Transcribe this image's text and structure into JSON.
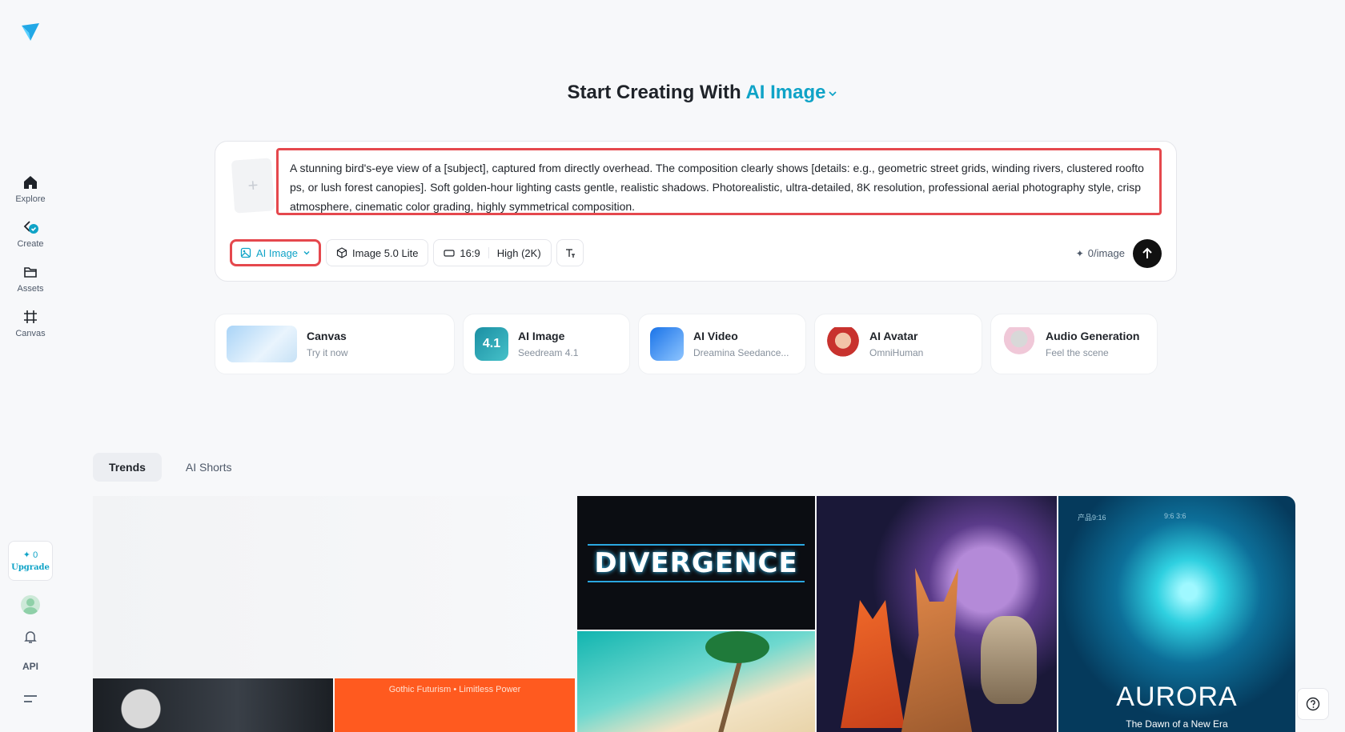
{
  "sidebar": {
    "items": [
      {
        "label": "Explore",
        "icon": "home-icon"
      },
      {
        "label": "Create",
        "icon": "create-icon"
      },
      {
        "label": "Assets",
        "icon": "folder-icon"
      },
      {
        "label": "Canvas",
        "icon": "canvas-icon"
      }
    ],
    "upgrade": {
      "credits": "0",
      "label": "Upgrade"
    },
    "api_label": "API"
  },
  "heading": {
    "prefix": "Start Creating With",
    "mode": "AI Image"
  },
  "prompt": {
    "text": "A stunning bird's-eye view of a [subject], captured from directly overhead. The composition clearly shows [details: e.g., geometric street grids, winding rivers, clustered rooftops, or lush forest canopies]. Soft golden-hour lighting casts gentle, realistic shadows. Photorealistic, ultra-detailed, 8K resolution, professional aerial photography style, crisp atmosphere, cinematic color grading, highly symmetrical composition.",
    "upload_symbol": "+"
  },
  "toolbar": {
    "mode_label": "AI Image",
    "model_label": "Image 5.0 Lite",
    "ratio_label": "16:9",
    "quality_label": "High (2K)",
    "cost_label": "0/image"
  },
  "features": [
    {
      "title": "Canvas",
      "subtitle": "Try it now"
    },
    {
      "title": "AI Image",
      "subtitle": "Seedream 4.1",
      "badge": "4.1"
    },
    {
      "title": "AI Video",
      "subtitle": "Dreamina Seedance..."
    },
    {
      "title": "AI Avatar",
      "subtitle": "OmniHuman"
    },
    {
      "title": "Audio Generation",
      "subtitle": "Feel the scene"
    }
  ],
  "tabs": [
    {
      "label": "Trends",
      "active": true
    },
    {
      "label": "AI Shorts",
      "active": false
    }
  ],
  "gallery": {
    "gothic_caption": "Gothic Futurism • Limitless Power",
    "divergence_title": "DIVERGENCE",
    "aurora_left_tag": "产品9:16",
    "aurora_right_tag": "9:6  3:6",
    "aurora_title": "AURORA",
    "aurora_tagline": "The Dawn of a New Era"
  },
  "colors": {
    "accent": "#0fa3c7",
    "highlight_border": "#e5484d",
    "send_button": "#111111"
  }
}
